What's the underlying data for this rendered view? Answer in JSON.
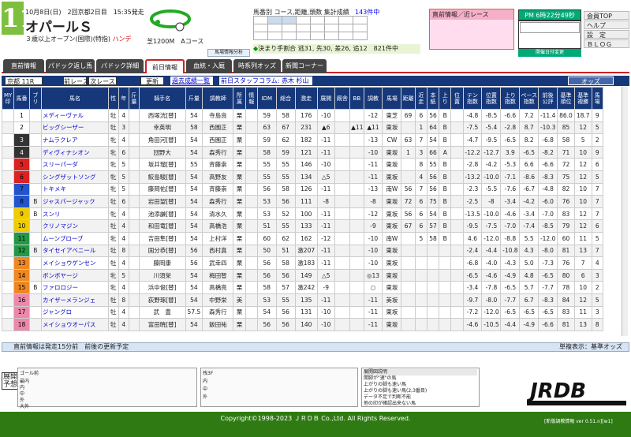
{
  "race": {
    "number": "11",
    "date": "10月8日(日)　2回京都2日目　15:35発走",
    "title": "オパールＳ",
    "conditions": "３歳以上オープン(国際)(特指)",
    "handicap": "ハンデ",
    "course": "芝1200M　Aコース"
  },
  "summary": {
    "label": "馬番別 コース,距離,頭数 集計成績",
    "class_count": "143件中",
    "decision": "決まり手割合 逃31, 先30, 差26, 追12　821件中",
    "analysis": "馬場情報分析",
    "days": [
      [
        "",
        "",
        "",
        "",
        "",
        "",
        "",
        ""
      ],
      [
        "",
        "",
        "",
        "",
        "",
        "",
        "",
        ""
      ],
      [
        "",
        "",
        "",
        "",
        "",
        "",
        "",
        ""
      ]
    ]
  },
  "info_panel": {
    "title": "直前情報／近レース"
  },
  "clock": {
    "text": "PM 6時22分49秒",
    "date_button": "開催日付変更"
  },
  "top_links": [
    "会員TOP",
    "ヘルプ",
    "設　定",
    "ＢＬＯＧ"
  ],
  "tabs": [
    "直前情報",
    "パドック返し馬",
    "パドック詳細",
    "前日情報",
    "血統・入厩",
    "時系列オッズ",
    "新聞コーナー"
  ],
  "toolbar": {
    "race_select": "京都 11R",
    "prev": "前レース",
    "next": "次レース",
    "update": "更新",
    "past": "過去成績一覧",
    "staff": "前日スタッフコラム: 赤木 杉山",
    "odds": "オッズ"
  },
  "columns": [
    "MY印",
    "馬番",
    "ブリ",
    "馬名",
    "性",
    "年",
    "斤量",
    "騎手名",
    "斤量",
    "調教師",
    "所属",
    "情報",
    "IDM",
    "総合",
    "激走",
    "展開",
    "厩舎",
    "BB",
    "調教",
    "馬場",
    "距離",
    "近走",
    "本紙",
    "上り",
    "位置",
    "テン指数",
    "位置指数",
    "上り指数",
    "ペース指数",
    "前後公評",
    "基準順位",
    "基準複勝",
    "馬場"
  ],
  "horses": [
    {
      "no": "1",
      "bl": "",
      "name": "メディーヴァル",
      "sex": "牡",
      "age": "4",
      "jockey": "西塚洸[替]",
      "wt": "54",
      "trainer": "寺島良",
      "aff": "栗",
      "idm": "59",
      "sogo": "58",
      "geki": "176",
      "ten": "-10",
      "bb": "",
      "tr": "-12",
      "ba": "東芝",
      "v1": "69",
      "v2": "6",
      "v3": "56",
      "v4": "B",
      "t": "-4.8",
      "p": "-8.5",
      "u": "-6.6",
      "pc": "7.2",
      "zk": "-11.4",
      "r": "86.0",
      "f": "18.7",
      "m": "9"
    },
    {
      "no": "2",
      "bl": "",
      "name": "ビッグシーザー",
      "sex": "牡",
      "age": "3",
      "jockey": "幸英明",
      "wt": "58",
      "trainer": "西園正",
      "aff": "栗",
      "idm": "63",
      "sogo": "67",
      "geki": "231",
      "ten": "▲6",
      "bb": "▲11",
      "tr": "▲11",
      "ba": "東坂",
      "v1": "",
      "v2": "1",
      "v3": "64",
      "v4": "B",
      "t": "-7.5",
      "p": "-5.4",
      "u": "-2.8",
      "pc": "8.7",
      "zk": "-10.3",
      "r": "85",
      "f": "12",
      "m": "5"
    },
    {
      "no": "3",
      "bl": "",
      "name": "ナムラクレア",
      "sex": "牝",
      "age": "4",
      "jockey": "角田河[替]",
      "wt": "54",
      "trainer": "西園正",
      "aff": "栗",
      "idm": "59",
      "sogo": "62",
      "geki": "182",
      "ten": "-11",
      "bb": "",
      "tr": "-13",
      "ba": "CW",
      "v1": "63",
      "v2": "7",
      "v3": "54",
      "v4": "B",
      "t": "-4.7",
      "p": "-9.5",
      "u": "-6.5",
      "pc": "8.2",
      "zk": "-6.8",
      "r": "58",
      "f": "5",
      "m": "2"
    },
    {
      "no": "4",
      "bl": "",
      "name": "ディヴィナシオン",
      "sex": "牝",
      "age": "6",
      "jockey": "団野大",
      "wt": "54",
      "trainer": "森秀行",
      "aff": "栗",
      "idm": "58",
      "sogo": "59",
      "geki": "121",
      "ten": "-11",
      "bb": "",
      "tr": "-10",
      "ba": "東坂",
      "v1": "1",
      "v2": "3",
      "v3": "66",
      "v4": "A",
      "t": "-12.2",
      "p": "-12.7",
      "u": "3.9",
      "pc": "-6.5",
      "zk": "-8.2",
      "r": "71",
      "f": "10",
      "m": "9"
    },
    {
      "no": "5",
      "bl": "",
      "name": "スリーパーダ",
      "sex": "牝",
      "age": "5",
      "jockey": "坂井瑠[替]",
      "wt": "55",
      "trainer": "斉藤崇",
      "aff": "栗",
      "idm": "55",
      "sogo": "55",
      "geki": "146",
      "ten": "-10",
      "bb": "",
      "tr": "-11",
      "ba": "東坂",
      "v1": "",
      "v2": "8",
      "v3": "55",
      "v4": "B",
      "t": "-2.8",
      "p": "-4.2",
      "u": "-5.3",
      "pc": "6.6",
      "zk": "-6.6",
      "r": "72",
      "f": "12",
      "m": "6"
    },
    {
      "no": "6",
      "bl": "",
      "name": "シングザットソング",
      "sex": "牝",
      "age": "5",
      "jockey": "鮫島駿[替]",
      "wt": "54",
      "trainer": "高野友",
      "aff": "栗",
      "idm": "55",
      "sogo": "55",
      "geki": "134",
      "ten": "△5",
      "bb": "",
      "tr": "-11",
      "ba": "東坂",
      "v1": "",
      "v2": "4",
      "v3": "56",
      "v4": "B",
      "t": "-13.2",
      "p": "-10.0",
      "u": "-7.1",
      "pc": "-8.6",
      "zk": "-8.3",
      "r": "75",
      "f": "12",
      "m": "5"
    },
    {
      "no": "7",
      "bl": "",
      "name": "トキメキ",
      "sex": "牝",
      "age": "5",
      "jockey": "藤岡佑[替]",
      "wt": "54",
      "trainer": "斉藤崇",
      "aff": "栗",
      "idm": "56",
      "sogo": "58",
      "geki": "126",
      "ten": "-11",
      "bb": "",
      "tr": "-13",
      "ba": "南W",
      "v1": "56",
      "v2": "7",
      "v3": "56",
      "v4": "B",
      "t": "-2.3",
      "p": "-5.5",
      "u": "-7.6",
      "pc": "-6.7",
      "zk": "-4.8",
      "r": "82",
      "f": "10",
      "m": "7"
    },
    {
      "no": "8",
      "bl": "B",
      "name": "ジャスパージャック",
      "sex": "牡",
      "age": "6",
      "jockey": "岩田望[替]",
      "wt": "54",
      "trainer": "森秀行",
      "aff": "栗",
      "idm": "53",
      "sogo": "56",
      "geki": "111",
      "ten": "-8",
      "bb": "",
      "tr": "-8",
      "ba": "東坂",
      "v1": "72",
      "v2": "6",
      "v3": "75",
      "v4": "B",
      "t": "-2.5",
      "p": "-8",
      "u": "-3.4",
      "pc": "-4.2",
      "zk": "-6.0",
      "r": "76",
      "f": "10",
      "m": "7"
    },
    {
      "no": "9",
      "bl": "B",
      "name": "スンリ",
      "sex": "牝",
      "age": "4",
      "jockey": "池添謙[替]",
      "wt": "54",
      "trainer": "清水久",
      "aff": "栗",
      "idm": "53",
      "sogo": "52",
      "geki": "100",
      "ten": "-11",
      "bb": "",
      "tr": "-12",
      "ba": "東坂",
      "v1": "56",
      "v2": "6",
      "v3": "54",
      "v4": "B",
      "t": "-13.5",
      "p": "-10.0",
      "u": "-4.6",
      "pc": "-3.4",
      "zk": "-7.0",
      "r": "83",
      "f": "12",
      "m": "7"
    },
    {
      "no": "10",
      "bl": "",
      "name": "クリノマジン",
      "sex": "牡",
      "age": "4",
      "jockey": "和田竜[替]",
      "wt": "54",
      "trainer": "高橋浩",
      "aff": "栗",
      "idm": "51",
      "sogo": "55",
      "geki": "133",
      "ten": "-11",
      "bb": "",
      "tr": "-9",
      "ba": "東坂",
      "v1": "67",
      "v2": "6",
      "v3": "57",
      "v4": "B",
      "t": "-9.5",
      "p": "-7.5",
      "u": "-7.0",
      "pc": "-7.4",
      "zk": "-8.5",
      "r": "79",
      "f": "12",
      "m": "6"
    },
    {
      "no": "11",
      "bl": "",
      "name": "ムーンプローブ",
      "sex": "牝",
      "age": "4",
      "jockey": "吉田隼[替]",
      "wt": "54",
      "trainer": "上村洋",
      "aff": "栗",
      "idm": "60",
      "sogo": "62",
      "geki": "162",
      "ten": "-12",
      "bb": "",
      "tr": "-10",
      "ba": "南W",
      "v1": "",
      "v2": "5",
      "v3": "58",
      "v4": "B",
      "t": "4.6",
      "p": "-12.0",
      "u": "-8.8",
      "pc": "5.5",
      "zk": "-12.0",
      "r": "60",
      "f": "11",
      "m": "5"
    },
    {
      "no": "12",
      "bl": "B",
      "name": "タイセイアベニール",
      "sex": "牡",
      "age": "8",
      "jockey": "国分恭[替]",
      "wt": "56",
      "trainer": "西村真",
      "aff": "栗",
      "idm": "50",
      "sogo": "51",
      "geki": "激207",
      "ten": "-11",
      "bb": "",
      "tr": "-10",
      "ba": "東坂",
      "v1": "",
      "v2": "",
      "v3": "",
      "v4": "",
      "t": "-2.4",
      "p": "-4.4",
      "u": "-10.8",
      "pc": "4.3",
      "zk": "-8.0",
      "r": "81",
      "f": "13",
      "m": "7"
    },
    {
      "no": "13",
      "bl": "",
      "name": "メイショウゲンセン",
      "sex": "牡",
      "age": "4",
      "jockey": "藤岡康",
      "wt": "56",
      "trainer": "武幸四",
      "aff": "栗",
      "idm": "56",
      "sogo": "58",
      "geki": "激183",
      "ten": "-11",
      "bb": "",
      "tr": "-10",
      "ba": "東坂",
      "v1": "",
      "v2": "",
      "v3": "",
      "v4": "",
      "t": "-6.8",
      "p": "-4.0",
      "u": "-4.3",
      "pc": "5.0",
      "zk": "-7.3",
      "r": "76",
      "f": "7",
      "m": "4"
    },
    {
      "no": "14",
      "bl": "",
      "name": "ボンボヤージ",
      "sex": "牝",
      "age": "5",
      "jockey": "川須栄",
      "wt": "54",
      "trainer": "梅田智",
      "aff": "栗",
      "idm": "56",
      "sogo": "56",
      "geki": "149",
      "ten": "△5",
      "bb": "",
      "tr": "◎13",
      "ba": "東坂",
      "v1": "",
      "v2": "",
      "v3": "",
      "v4": "",
      "t": "-6.5",
      "p": "-4.6",
      "u": "-4.9",
      "pc": "4.8",
      "zk": "-6.5",
      "r": "80",
      "f": "6",
      "m": "3"
    },
    {
      "no": "15",
      "bl": "B",
      "name": "ファロロジー",
      "sex": "牝",
      "age": "4",
      "jockey": "浜中俊[替]",
      "wt": "54",
      "trainer": "高橋亮",
      "aff": "栗",
      "idm": "58",
      "sogo": "57",
      "geki": "激242",
      "ten": "-9",
      "bb": "",
      "tr": "○",
      "ba": "東坂",
      "v1": "",
      "v2": "",
      "v3": "",
      "v4": "",
      "t": "-3.4",
      "p": "-7.8",
      "u": "-6.5",
      "pc": "5.7",
      "zk": "-7.7",
      "r": "78",
      "f": "10",
      "m": "2"
    },
    {
      "no": "16",
      "bl": "",
      "name": "カイザーメランジェ",
      "sex": "牡",
      "age": "8",
      "jockey": "荻野琢[替]",
      "wt": "54",
      "trainer": "中野栄",
      "aff": "美",
      "idm": "53",
      "sogo": "55",
      "geki": "135",
      "ten": "-11",
      "bb": "",
      "tr": "-11",
      "ba": "美坂",
      "v1": "",
      "v2": "",
      "v3": "",
      "v4": "",
      "t": "-9.7",
      "p": "-8.0",
      "u": "-7.7",
      "pc": "6.7",
      "zk": "-8.3",
      "r": "84",
      "f": "12",
      "m": "5"
    },
    {
      "no": "17",
      "bl": "",
      "name": "ジャングロ",
      "sex": "牡",
      "age": "4",
      "jockey": "武　豊",
      "wt": "57.5",
      "trainer": "森秀行",
      "aff": "栗",
      "idm": "54",
      "sogo": "56",
      "geki": "131",
      "ten": "-10",
      "bb": "",
      "tr": "-11",
      "ba": "東坂",
      "v1": "",
      "v2": "",
      "v3": "",
      "v4": "",
      "t": "-7.2",
      "p": "-12.0",
      "u": "-6.5",
      "pc": "-6.5",
      "zk": "-6.5",
      "r": "83",
      "f": "11",
      "m": "3"
    },
    {
      "no": "18",
      "bl": "",
      "name": "メイショウオーパス",
      "sex": "牡",
      "age": "4",
      "jockey": "富田暁[替]",
      "wt": "54",
      "trainer": "飯田祐",
      "aff": "栗",
      "idm": "56",
      "sogo": "56",
      "geki": "140",
      "ten": "-10",
      "bb": "",
      "tr": "-11",
      "ba": "東坂",
      "v1": "",
      "v2": "",
      "v3": "",
      "v4": "",
      "t": "-4.6",
      "p": "-10.5",
      "u": "-4.4",
      "pc": "-4.9",
      "zk": "-6.6",
      "r": "81",
      "f": "13",
      "m": "8"
    }
  ],
  "frame_colors": [
    "#ffffff",
    "#ffffff",
    "#333333",
    "#333333",
    "#dd2222",
    "#dd2222",
    "#2255cc",
    "#2255cc",
    "#eecc00",
    "#eecc00",
    "#229944",
    "#229944",
    "#ee8822",
    "#ee8822",
    "#ee8822",
    "#ee88aa",
    "#ee88aa",
    "#ee88aa"
  ],
  "status": {
    "left": "直前情報は発走15分前　前後の更新予定",
    "right": "単複表示：基準オッズ"
  },
  "pace": {
    "label": "展開予想",
    "goal_label": "ゴール前",
    "turn_label": "残3F",
    "goal_rows": [
      "最内",
      "内",
      "中",
      "外",
      "大外"
    ],
    "turn_rows": [
      "内",
      "中",
      "外"
    ]
  },
  "legend": {
    "title": "展開図説明",
    "items": [
      "開脚が\"速\"の馬",
      "上がりの脚も速い馬",
      "上がりの脚も速い馬(2,3番目)",
      "データ不足で判断不能",
      "他の印が確認出来ない馬",
      "その他の馬"
    ]
  },
  "footer": {
    "copyright": "Copyright©1998-2023 ＪＲＤＢ Co.,Ltd. All Rights Reserved.",
    "version": "[新版調教情報 ver 0.51.n][w1]",
    "logo": "JRDB"
  },
  "colors": {
    "header_blue": "#16387a",
    "tab_red": "#cc2222",
    "footer_green": "#2f7a13"
  }
}
